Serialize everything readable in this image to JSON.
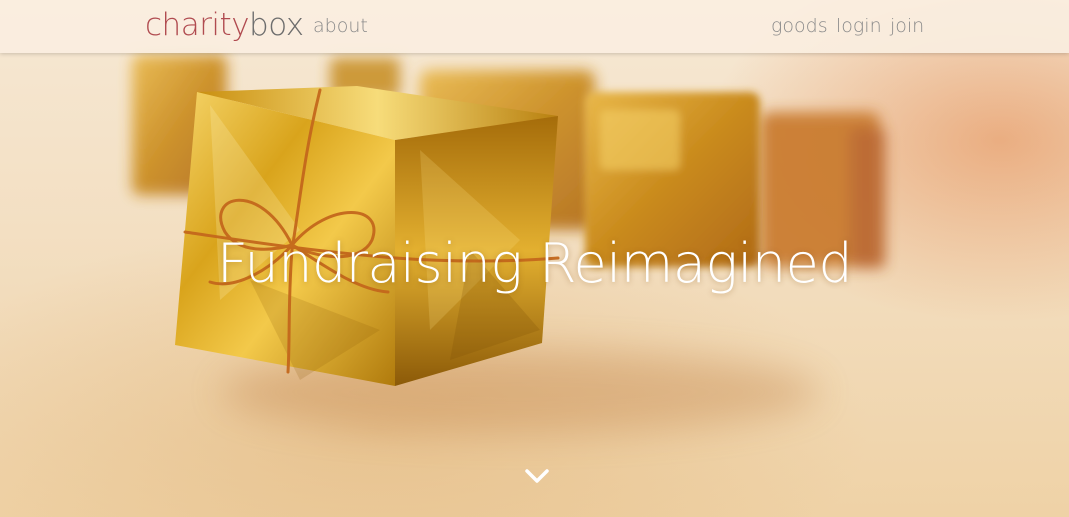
{
  "brand": {
    "part1": "charity",
    "part2": "box"
  },
  "nav": {
    "about": "about",
    "goods": "goods",
    "login": "login",
    "join": "join"
  },
  "hero": {
    "headline": "Fundraising Reimagined",
    "scroll_icon": "chevron-down-icon"
  },
  "colors": {
    "brand_accent": "#b04a4f",
    "brand_gray": "#6d6d6d",
    "nav_text": "#8a8a8a",
    "gold": "#d9a41c"
  }
}
